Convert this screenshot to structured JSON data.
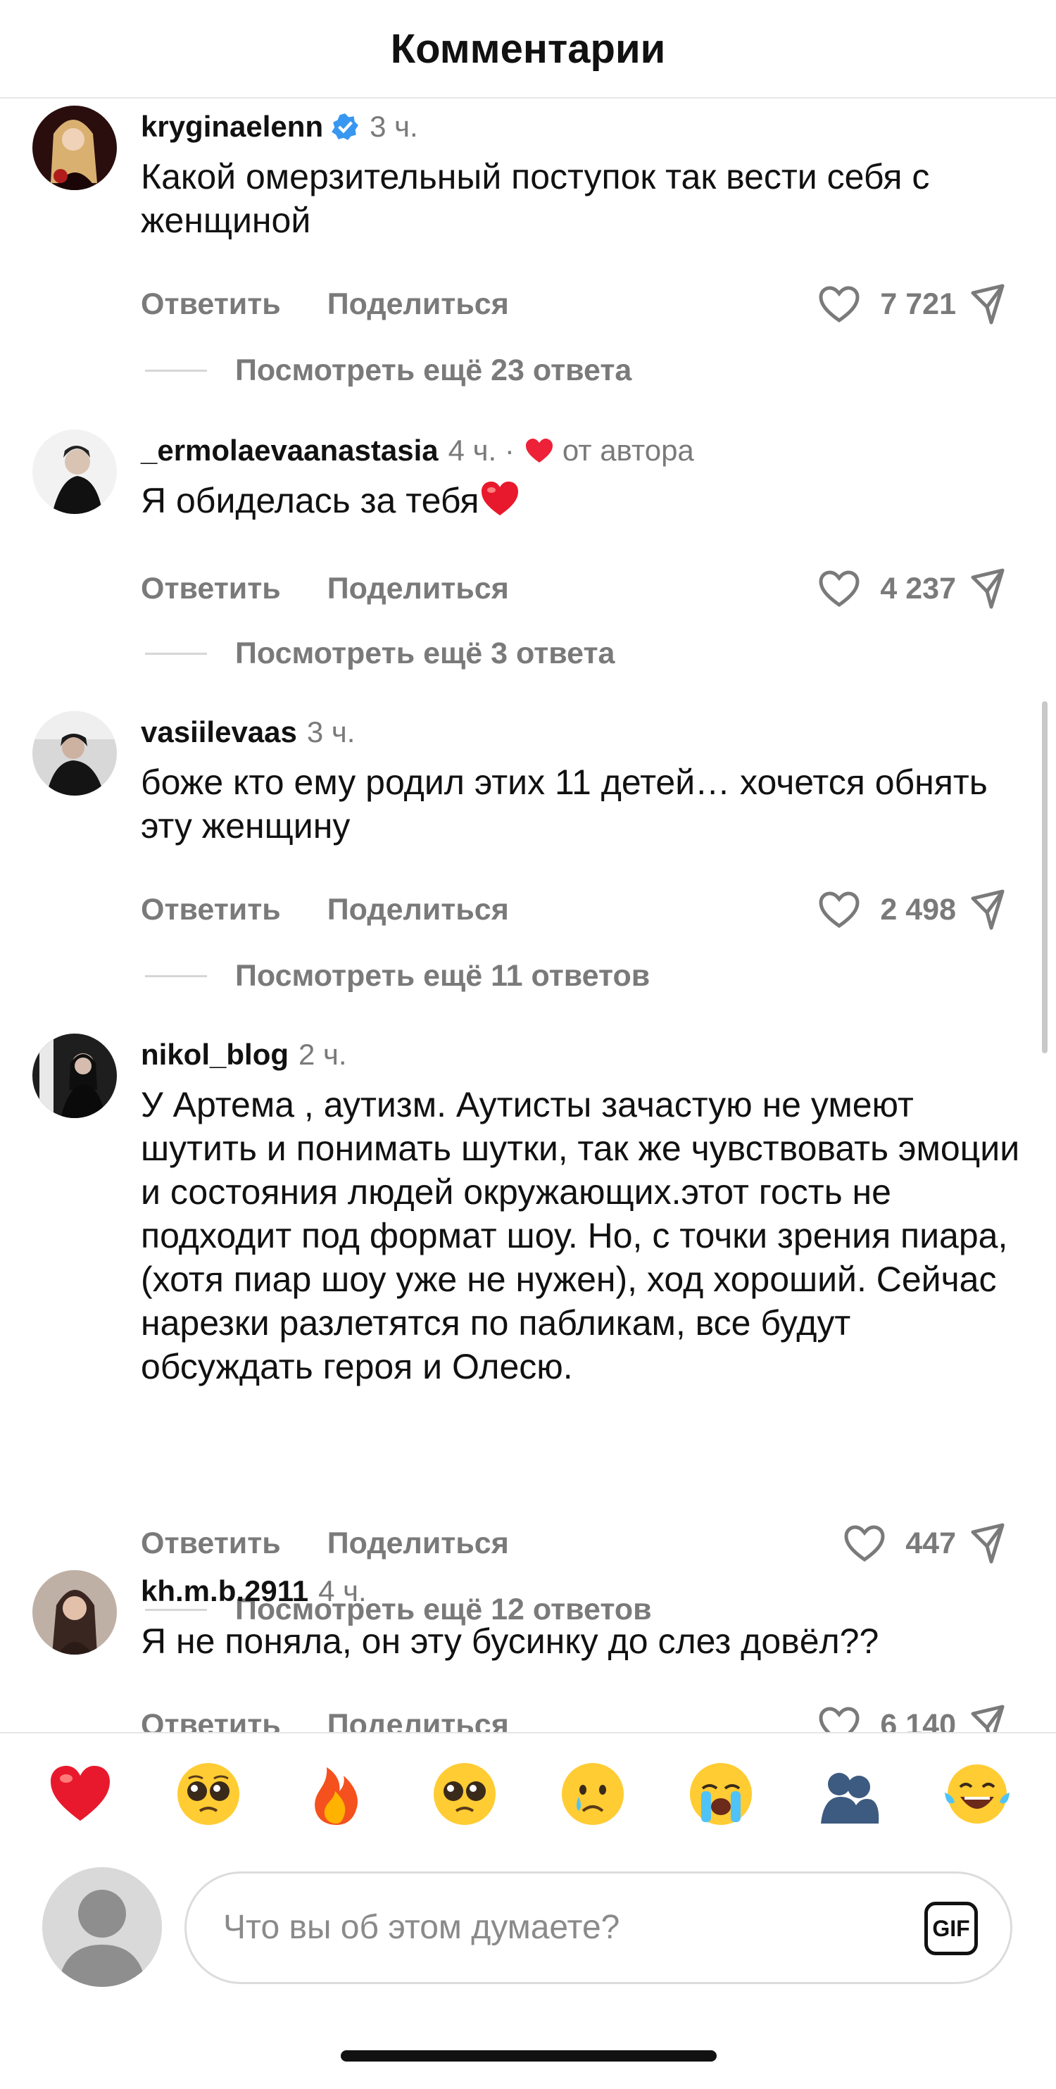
{
  "header": {
    "title": "Комментарии"
  },
  "labels": {
    "reply": "Ответить",
    "share": "Поделиться"
  },
  "comments": [
    {
      "username": "kryginaelenn",
      "verified": true,
      "time": "3 ч.",
      "text": "Какой омерзительный поступок так вести себя с женщиной",
      "likes": "7 721",
      "replies": "Посмотреть ещё 23 ответа"
    },
    {
      "username": "_ermolaevaanastasia",
      "time": "4 ч. ·",
      "by_author": "от автора",
      "text": "Я обиделась за тебя",
      "text_emoji": "red-heart-emoji",
      "likes": "4 237",
      "replies": "Посмотреть ещё 3 ответа"
    },
    {
      "username": "vasiilevaas",
      "time": "3 ч.",
      "text": "боже кто ему родил этих 11 детей… хочется обнять эту женщину",
      "likes": "2 498",
      "replies": "Посмотреть ещё 11 ответов"
    },
    {
      "username": "nikol_blog",
      "time": "2 ч.",
      "text": "У Артема , аутизм. Аутисты зачастую не умеют шутить и понимать шутки, так же чувствовать эмоции и состояния людей окружающих.этот гость не подходит под формат шоу. Но, с точки зрения пиара, (хотя пиар шоу уже не нужен), ход хороший. Сейчас нарезки разлетятся по пабликам, все будут обсуждать героя и Олесю.",
      "likes": "447",
      "replies": "Посмотреть ещё 12 ответов"
    },
    {
      "username": "kh.m.b.2911",
      "time": "4 ч.",
      "text": "Я не поняла, он эту бусинку до слез довёл??",
      "likes": "6 140"
    }
  ],
  "emoji_bar": [
    "red-heart",
    "pleading-face",
    "fire",
    "pleading-face",
    "crying-face",
    "loudly-crying-face",
    "people-hugging",
    "face-with-tears-of-joy"
  ],
  "composer": {
    "placeholder": "Что вы об этом думаете?",
    "gif_label": "GIF"
  }
}
